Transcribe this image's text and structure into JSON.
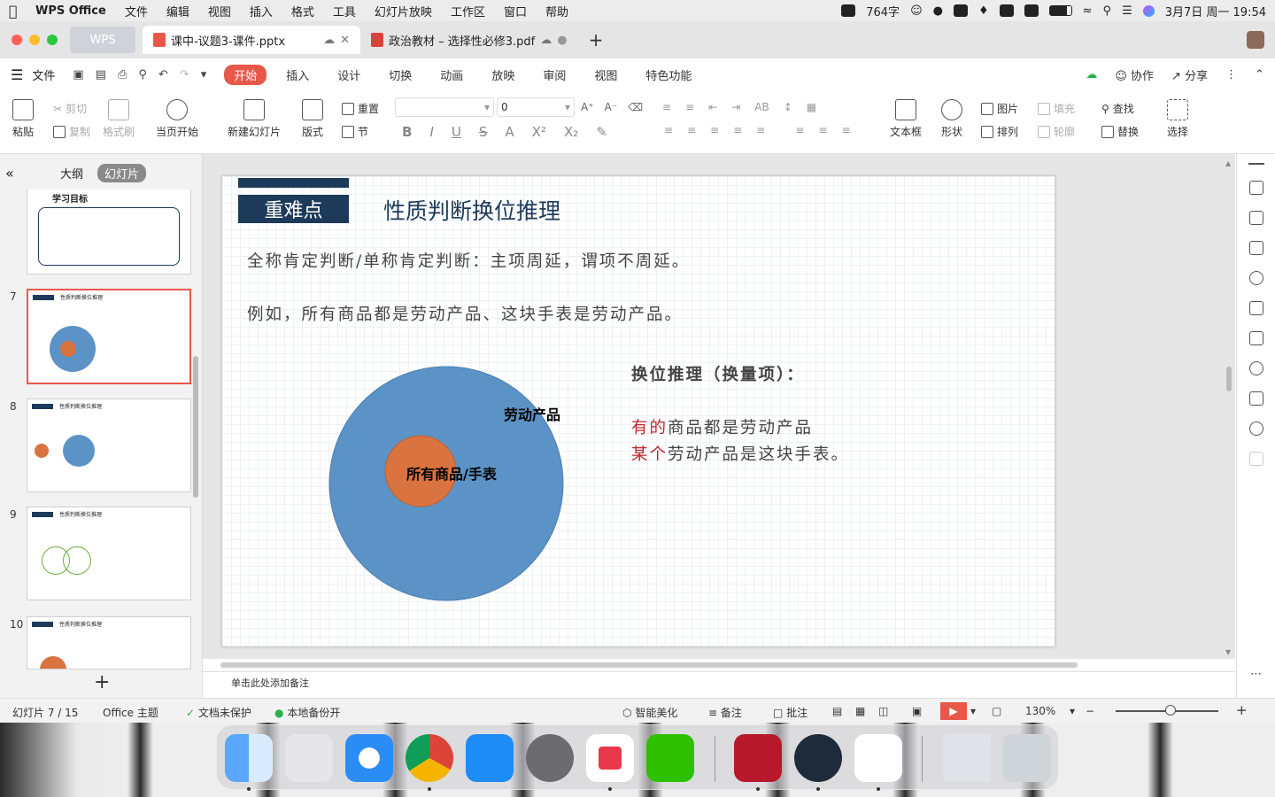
{
  "menubar": {
    "app_name": "WPS Office",
    "items": [
      "文件",
      "编辑",
      "视图",
      "插入",
      "格式",
      "工具",
      "幻灯片放映",
      "工作区",
      "窗口",
      "帮助"
    ],
    "word_count": "764字",
    "datetime": "3月7日 周一  19:54"
  },
  "tabs": {
    "home": "WPS",
    "active_doc": "课中-议题3-课件.pptx",
    "second_doc": "政治教材 – 选择性必修3.pdf"
  },
  "ribbon": {
    "file": "文件",
    "tabs": [
      "开始",
      "插入",
      "设计",
      "切换",
      "动画",
      "放映",
      "审阅",
      "视图",
      "特色功能"
    ],
    "collab": "协作",
    "share": "分享"
  },
  "toolbar": {
    "paste": "粘贴",
    "cut": "剪切",
    "copy": "复制",
    "format_painter": "格式刷",
    "play_from_current": "当页开始",
    "new_slide": "新建幻灯片",
    "layout": "版式",
    "reset": "重置",
    "section": "节",
    "font_size": "0",
    "textbox": "文本框",
    "shape": "形状",
    "picture": "图片",
    "arrange": "排列",
    "fill": "填充",
    "outline": "轮廓",
    "find": "查找",
    "replace": "替换",
    "select": "选择"
  },
  "left_panel": {
    "outline_tab": "大纲",
    "slides_tab": "幻灯片",
    "thumbs": [
      {
        "num": "",
        "title": "学习目标"
      },
      {
        "num": "7",
        "title": "性质判断换位推理"
      },
      {
        "num": "8",
        "title": "性质判断换位推理"
      },
      {
        "num": "9",
        "title": "性质判断换位推理"
      },
      {
        "num": "10",
        "title": "性质判断换位推理"
      }
    ]
  },
  "slide": {
    "tag": "重难点",
    "title": "性质判断换位推理",
    "line1": "全称肯定判断/单称肯定判断：主项周延，谓项不周延。",
    "line2": "例如，所有商品都是劳动产品、这块手表是劳动产品。",
    "outer_label": "劳动产品",
    "inner_label": "所有商品/手表",
    "conv_title": "换位推理（换量项）：",
    "conv_l1_red": "有的",
    "conv_l1_rest": "商品都是劳动产品",
    "conv_l2_red": "某个",
    "conv_l2_rest": "劳动产品是这块手表。",
    "colors": {
      "outer": "#5b93c7",
      "inner": "#d9733f",
      "accent": "#c0262d",
      "navy": "#1d3a5a"
    }
  },
  "notes_placeholder": "单击此处添加备注",
  "status": {
    "slide_info": "幻灯片 7 / 15",
    "theme": "Office 主题",
    "protect": "文档未保护",
    "backup": "本地备份开",
    "beautify": "智能美化",
    "notes": "备注",
    "comments": "批注",
    "zoom": "130%"
  }
}
